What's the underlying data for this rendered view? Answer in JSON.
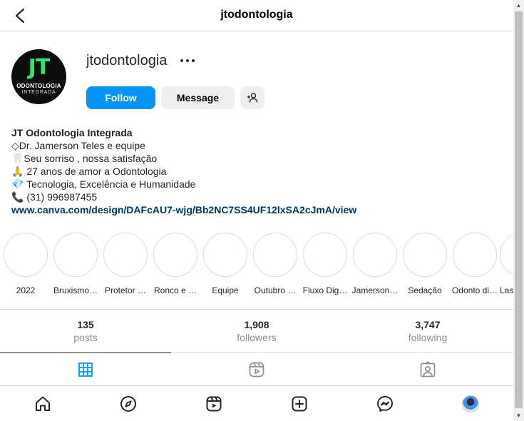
{
  "header": {
    "title": "jtodontologia",
    "back_icon": "chevron-left-icon"
  },
  "profile": {
    "username": "jtodontologia",
    "avatar": {
      "logo_text": "JT",
      "line1": "ODONTOLOGIA",
      "line2": "INTEGRADA",
      "logo_color": "#2de86e",
      "bg_color": "#0c0c0c"
    },
    "more_icon": "more-horizontal-icon"
  },
  "actions": {
    "follow_label": "Follow",
    "message_label": "Message",
    "suggest_icon": "add-person-icon",
    "follow_color": "#0095f6"
  },
  "bio": {
    "name": "JT Odontologia Integrada",
    "lines": [
      "◇Dr. Jamerson Teles e equipe",
      "🦷Seu sorriso , nossa satisfação",
      "🙏 27 anos de amor a Odontologia",
      "💎 Tecnologia, Excelência e Humanidade",
      "📞 (31) 996987455"
    ],
    "link": "www.canva.com/design/DAFcAU7-wjg/Bb2NC7SS4UF12lxSA2cJmA/view",
    "link_color": "#00376b"
  },
  "highlights": [
    {
      "label": "2022"
    },
    {
      "label": "Bruxismo…"
    },
    {
      "label": "Protetor …"
    },
    {
      "label": "Ronco e …"
    },
    {
      "label": "Equipe"
    },
    {
      "label": "Outubro …"
    },
    {
      "label": "Fluxo Dig…"
    },
    {
      "label": "Jamerson…"
    },
    {
      "label": "Sedação"
    },
    {
      "label": "Odonto di…"
    },
    {
      "label": "Las…"
    }
  ],
  "stats": [
    {
      "value": "135",
      "label": "posts"
    },
    {
      "value": "1,908",
      "label": "followers"
    },
    {
      "value": "3,747",
      "label": "following"
    }
  ],
  "tabs": [
    {
      "icon": "grid-icon",
      "active": true,
      "active_color": "#0095f6"
    },
    {
      "icon": "reels-icon",
      "active": false
    },
    {
      "icon": "tagged-icon",
      "active": false
    }
  ],
  "bottom_nav": [
    {
      "icon": "home-icon"
    },
    {
      "icon": "explore-icon"
    },
    {
      "icon": "reels-icon"
    },
    {
      "icon": "new-post-icon"
    },
    {
      "icon": "messenger-icon"
    },
    {
      "icon": "profile-avatar"
    }
  ]
}
